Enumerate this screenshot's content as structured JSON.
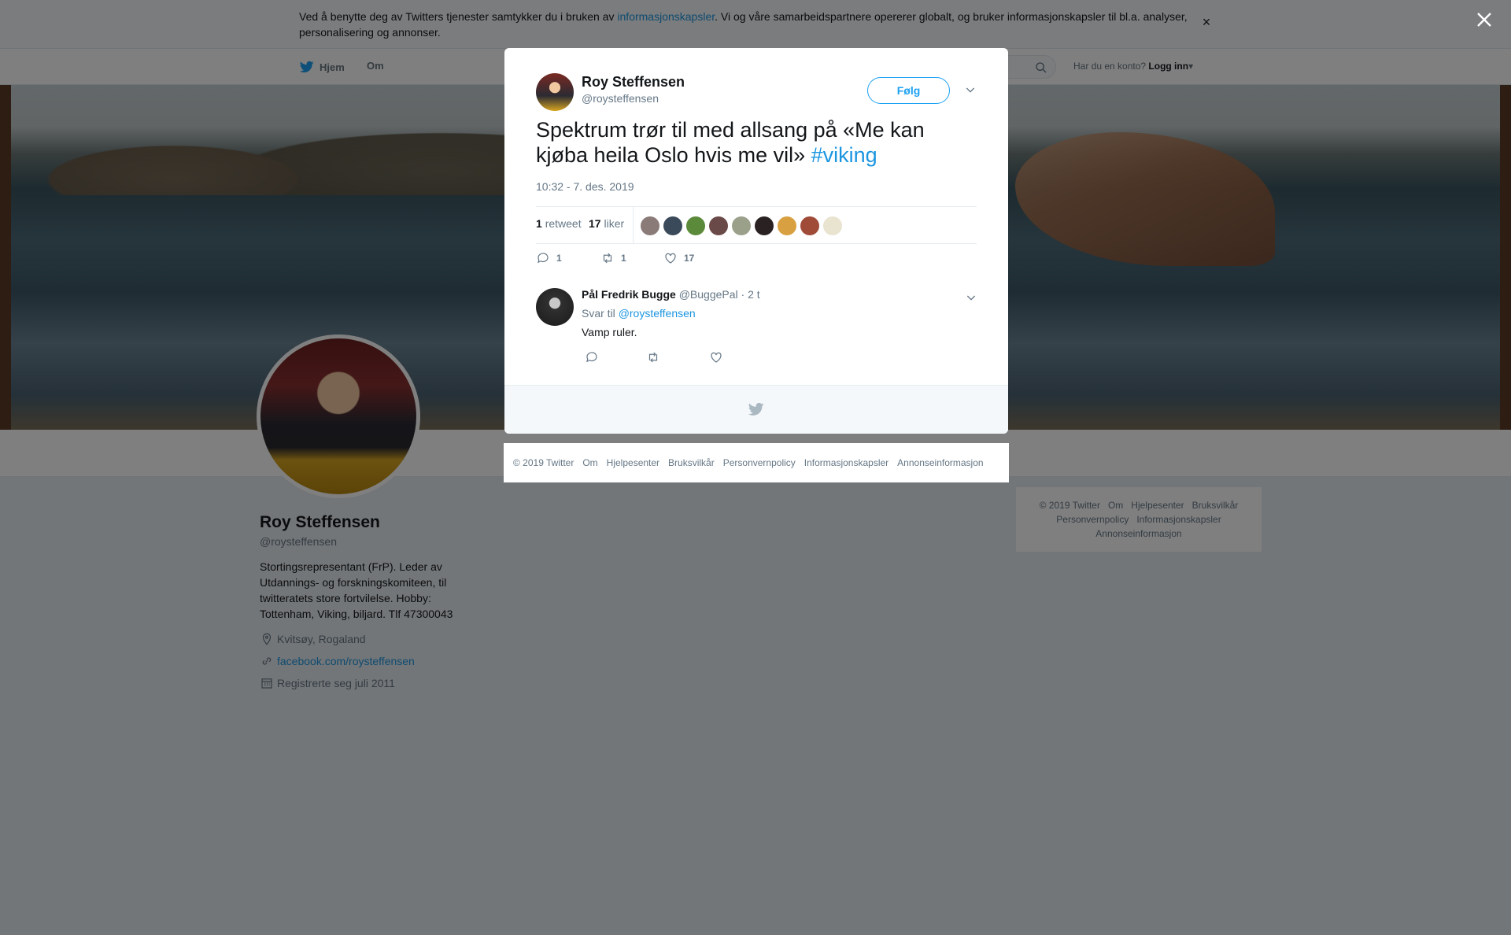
{
  "cookie_banner": {
    "text_before_link": "Ved å benytte deg av Twitters tjenester samtykker du i bruken av ",
    "link": "informasjonskapsler",
    "text_after_link": ". Vi og våre samarbeidspartnere opererer globalt, og bruker informasjonskapsler til bl.a. analyser, personalisering og annonser.",
    "close_icon": "close-icon"
  },
  "nav": {
    "home": "Hjem",
    "about": "Om",
    "search_icon": "search-icon",
    "login_prompt": "Har du en konto?",
    "login_label": "Logg inn"
  },
  "profile": {
    "name": "Roy Steffensen",
    "handle": "@roysteffensen",
    "bio": "Stortingsrepresentant (FrP). Leder av Utdannings- og forskningskomiteen, til twitteratets store fortvilelse. Hobby: Tottenham, Viking, biljard. Tlf 47300043",
    "location": "Kvitsøy, Rogaland",
    "website": "facebook.com/roysteffensen",
    "joined": "Registrerte seg juli 2011"
  },
  "side_footer": {
    "items": [
      "© 2019 Twitter",
      "Om",
      "Hjelpesenter",
      "Bruksvilkår",
      "Personvernpolicy",
      "Informasjonskapsler",
      "Annonseinformasjon"
    ]
  },
  "tweet": {
    "author_name": "Roy Steffensen",
    "author_handle": "@roysteffensen",
    "follow_label": "Følg",
    "text": "Spektrum trør til med allsang på «Me kan kjøba heila Oslo hvis me vil» ",
    "hashtag": "#viking",
    "timestamp": "10:32 - 7. des. 2019",
    "retweets_count": "1",
    "retweets_label": "retweet",
    "likes_count": "17",
    "likes_label": "liker",
    "reply_action_count": "1",
    "retweet_action_count": "1",
    "like_action_count": "17",
    "liker_colors": [
      "#8a7a78",
      "#3a4a5a",
      "#5a8a3a",
      "#6a4a48",
      "#9aa08a",
      "#2a2222",
      "#d8a040",
      "#a04a38",
      "#e8e4d0"
    ]
  },
  "reply": {
    "author_name": "Pål Fredrik Bugge",
    "author_handle": "@BuggePal",
    "time": "· 2 t",
    "reply_to_label": "Svar til",
    "reply_to_handle": "@roysteffensen",
    "text": "Vamp ruler."
  },
  "legal_footer": {
    "items": [
      "© 2019 Twitter",
      "Om",
      "Hjelpesenter",
      "Bruksvilkår",
      "Personvernpolicy",
      "Informasjonskapsler",
      "Annonseinformasjon"
    ]
  },
  "colors": {
    "accent": "#1da1f2",
    "link": "#1b95e0",
    "secondary_text": "#657786"
  }
}
